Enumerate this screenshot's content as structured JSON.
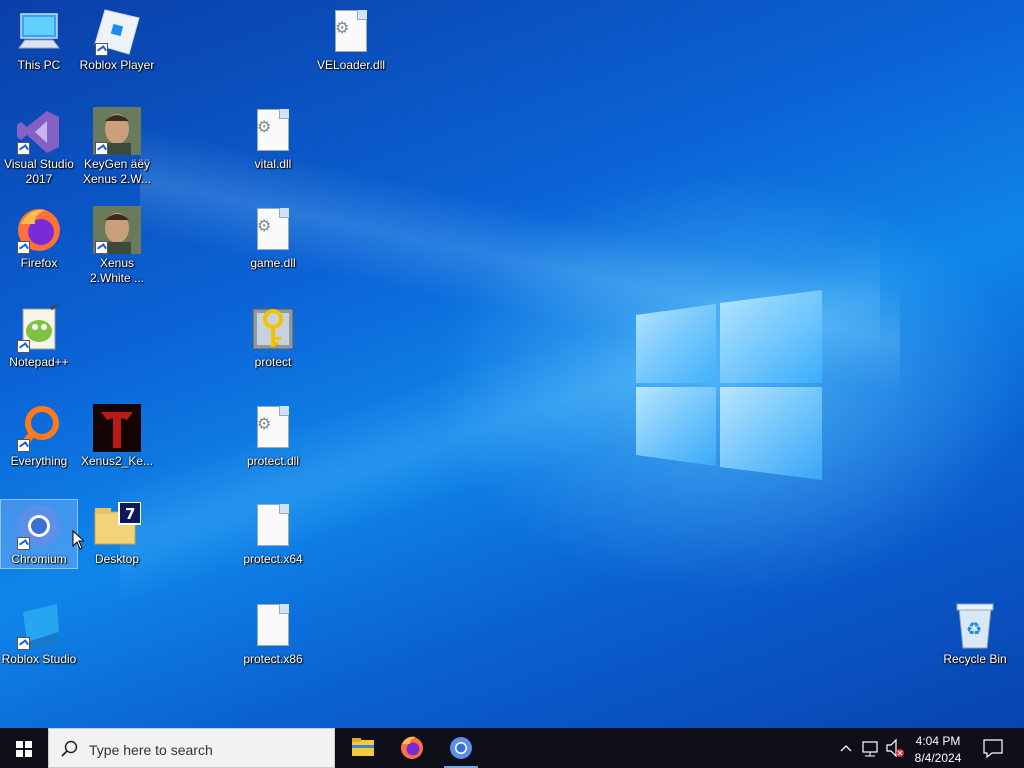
{
  "desktop": {
    "icons": {
      "this_pc": "This PC",
      "roblox_player": "Roblox Player",
      "veloader": "VELoader.dll",
      "visual_studio_1": "Visual Studio",
      "visual_studio_2": "2017",
      "keygen_1": "KeyGen äëÿ",
      "keygen_2": "Xenus 2.W...",
      "vital": "vital.dll",
      "firefox": "Firefox",
      "xenus_white_1": "Xenus",
      "xenus_white_2": "2.White ...",
      "game": "game.dll",
      "notepadpp": "Notepad++",
      "protect": "protect",
      "everything": "Everything",
      "xenus2_ke": "Xenus2_Ke...",
      "protect_dll": "protect.dll",
      "chromium": "Chromium",
      "desktop_folder": "Desktop",
      "protect_x64": "protect.x64",
      "roblox_studio": "Roblox Studio",
      "protect_x86": "protect.x86",
      "recycle_bin": "Recycle Bin"
    }
  },
  "taskbar": {
    "search_placeholder": "Type here to search",
    "clock_time": "4:04 PM",
    "clock_date": "8/4/2024"
  },
  "colors": {
    "accent": "#0b63d6",
    "taskbar": "#0f0f1a"
  }
}
